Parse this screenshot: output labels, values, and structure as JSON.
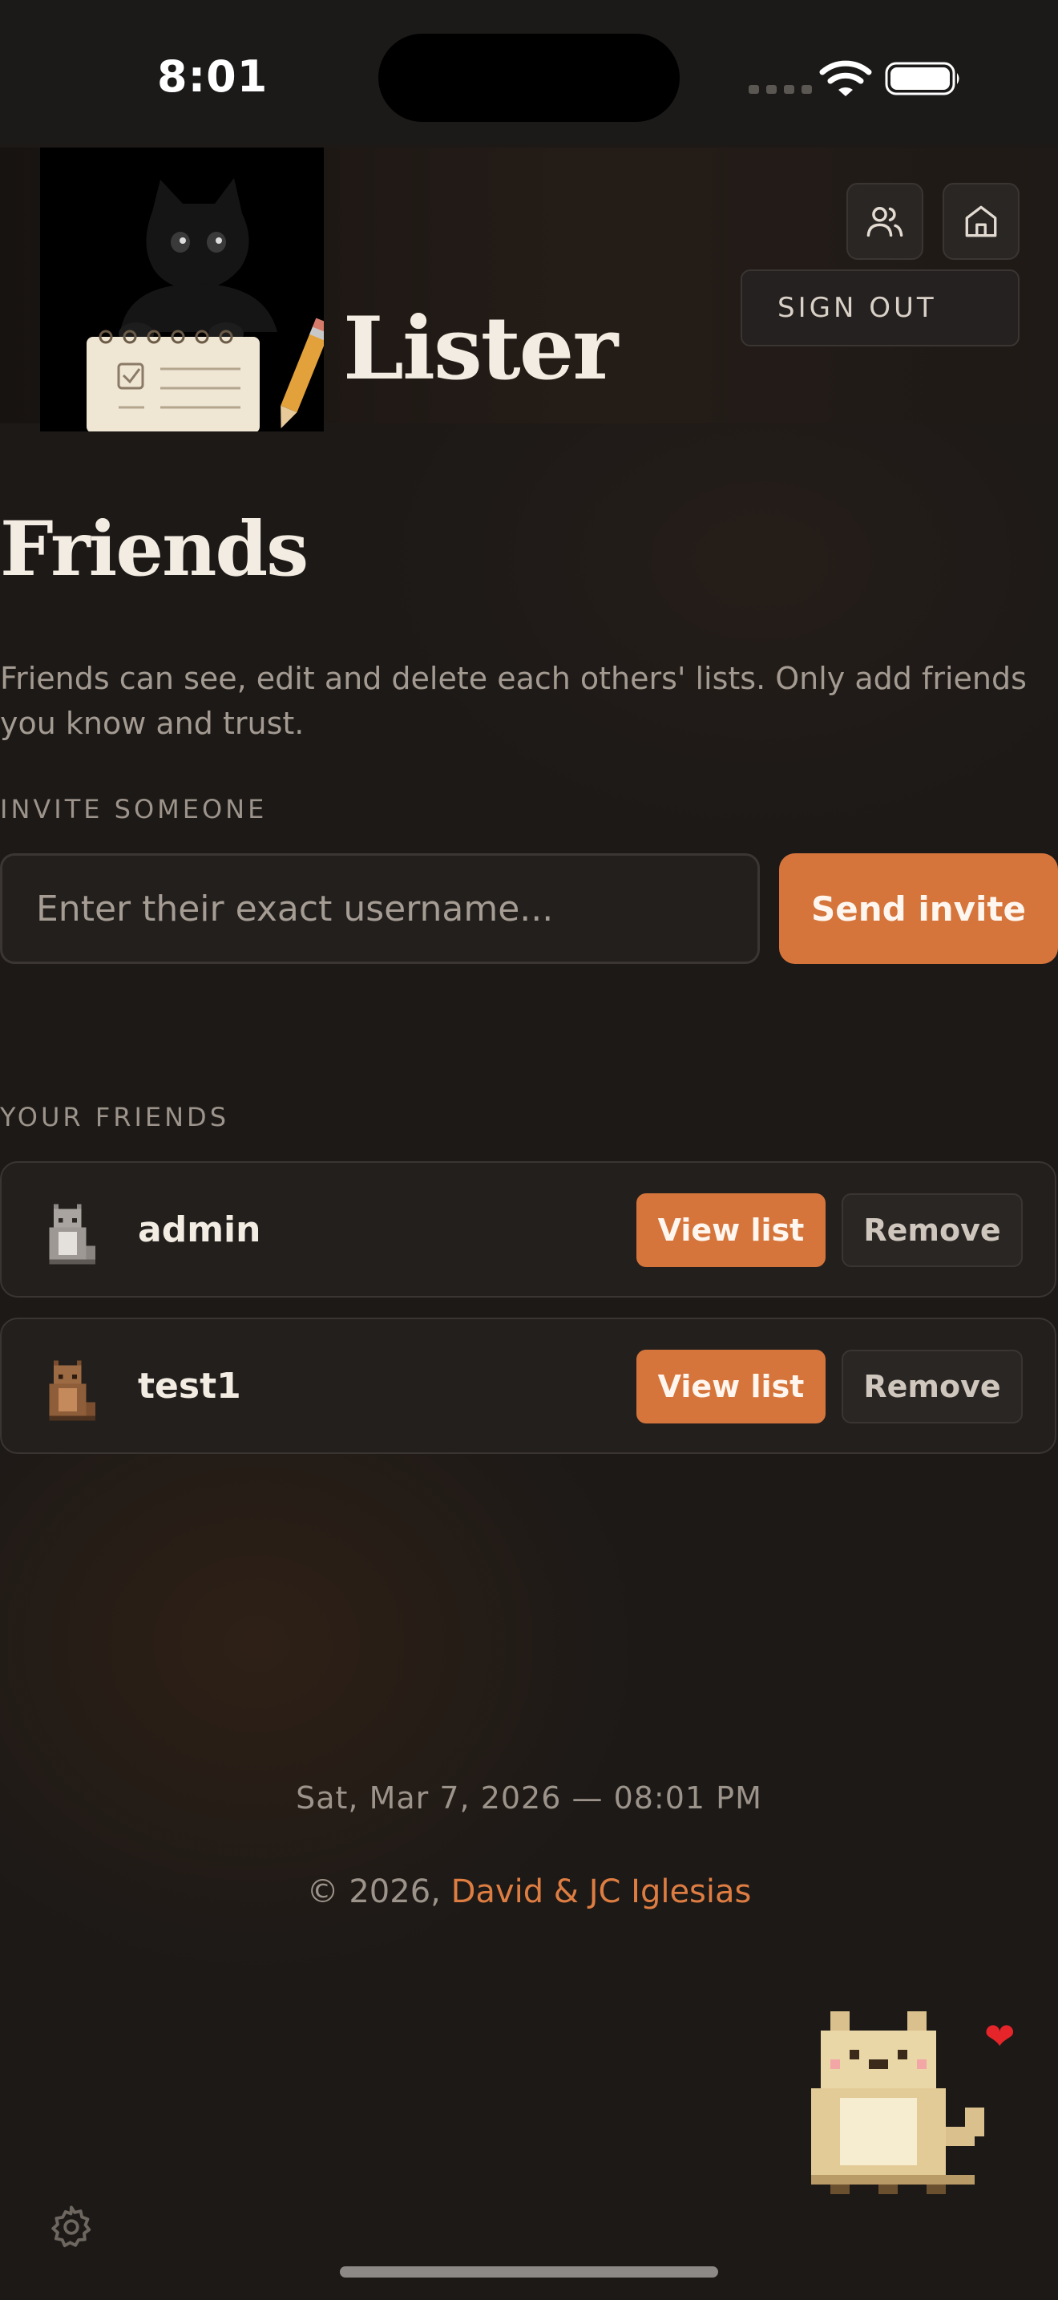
{
  "status_bar": {
    "time": "8:01"
  },
  "header": {
    "app_title": "Lister",
    "signout_label": "SIGN OUT"
  },
  "page": {
    "title": "Friends",
    "description": "Friends can see, edit and delete each others' lists. Only add friends you know and trust."
  },
  "invite": {
    "label": "INVITE SOMEONE",
    "placeholder": "Enter their exact username...",
    "send_label": "Send invite"
  },
  "friends": {
    "label": "YOUR FRIENDS",
    "items": [
      {
        "name": "admin",
        "view_label": "View list",
        "remove_label": "Remove"
      },
      {
        "name": "test1",
        "view_label": "View list",
        "remove_label": "Remove"
      }
    ]
  },
  "footer": {
    "datetime": "Sat, Mar 7, 2026 — 08:01 PM",
    "copyright_prefix": "© 2026,",
    "authors": "David & JC Iglesias"
  },
  "colors": {
    "accent": "#d5753c",
    "background": "#1c1917",
    "card": "#221f1d",
    "border": "#3a3532"
  },
  "icons": [
    "wifi-icon",
    "battery-icon",
    "friends-icon",
    "home-icon",
    "gear-icon",
    "heart-icon"
  ]
}
